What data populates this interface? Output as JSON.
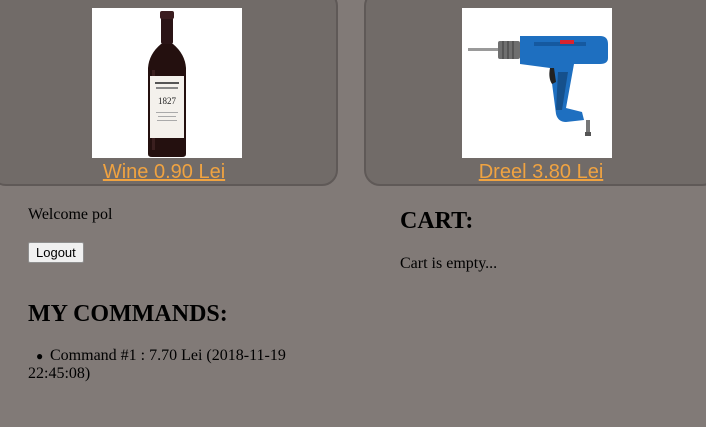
{
  "products": [
    {
      "name": "Wine",
      "price": "0.90 Lei",
      "link_text": "Wine 0.90 Lei",
      "image_icon": "wine-bottle-image",
      "bottle_label_text": "1827"
    },
    {
      "name": "Dreel",
      "price": "3.80 Lei",
      "link_text": "Dreel 3.80 Lei",
      "image_icon": "drill-image"
    }
  ],
  "user": {
    "welcome_text": "Welcome pol",
    "logout_label": "Logout"
  },
  "commands": {
    "heading": "MY COMMANDS:",
    "items": [
      {
        "bullet": "●",
        "text": "Command #1 :  7.70 Lei (2018-11-19 22:45:08)"
      }
    ]
  },
  "cart": {
    "heading": "CART:",
    "status_text": "Cart is empty..."
  },
  "colors": {
    "page_background": "#817a77",
    "card_background": "#716b68",
    "link": "#f0a341",
    "drill_body": "#1e6fc0"
  }
}
